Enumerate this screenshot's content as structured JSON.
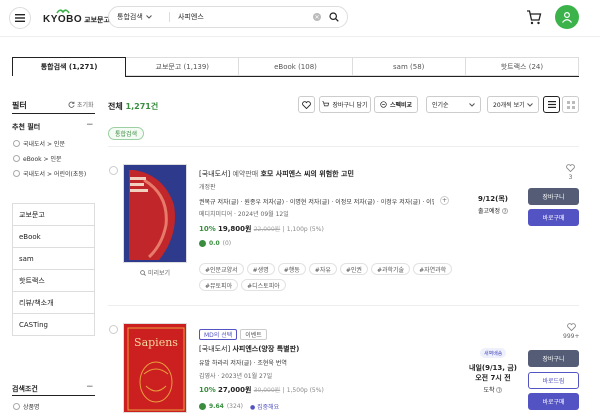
{
  "header": {
    "logo_text": "KYOBO",
    "logo_ko": "교보문고",
    "search_scope": "통합검색",
    "search_value": "사피엔스"
  },
  "tabs": [
    {
      "label": "통합검색 (1,271)",
      "active": true
    },
    {
      "label": "교보문고 (1,139)"
    },
    {
      "label": "eBook (108)"
    },
    {
      "label": "sam (58)"
    },
    {
      "label": "핫트랙스 (24)"
    }
  ],
  "filter": {
    "title": "필터",
    "reset": "초기화",
    "recommend_title": "추천 필터",
    "chips": [
      "국내도서 > 인문",
      "eBook > 인문",
      "국내도서 > 어린이(초등)"
    ],
    "menu": [
      "교보문고",
      "eBook",
      "sam",
      "핫트랙스",
      "리뷰/책소개",
      "CASTing"
    ],
    "search_cond_title": "검색조건",
    "product_name": "상품명"
  },
  "results": {
    "total_label": "전체",
    "total_count": "1,271건",
    "tools": {
      "cart": "장바구니 담기",
      "compare": "스펙비교",
      "sort": "인기순",
      "per_page": "20개씩 보기"
    },
    "category_badge": "통합검색",
    "items": [
      {
        "category": "[국내도서]",
        "status": "예약판매",
        "title": "호모 사피엔스 씨의 위험한 고민",
        "subtitle": "개정판",
        "authors": "권복규 저자(글) · 원종우 저자(글) · 이명현 저자(글) · 이정모 저자(글) · 이정우 저자(글) · 이필립",
        "more_authors": "+",
        "publisher": "메디치미디어 · 2024년 09월 12일",
        "discount": "10%",
        "price": "19,800원",
        "original_price": "22,000원",
        "points": "1,100p (5%)",
        "rating": "0.0",
        "review_count": "(0)",
        "tags": [
          "#인문교양서",
          "#생명",
          "#행동",
          "#자유",
          "#인권",
          "#과학기술",
          "#자연과학",
          "#뮤토피아",
          "#디스토피아"
        ],
        "preview": "미리보기",
        "like_count": "3",
        "delivery_date": "9/12(목)",
        "delivery_note": "출고예정",
        "btn_cart": "장바구니",
        "btn_buy": "바로구매"
      },
      {
        "badge_md": "MD의 선택",
        "badge_event": "이벤트",
        "category": "[국내도서]",
        "title": "사피엔스(양장 특별판)",
        "authors": "유발 하라리 저자(글) · 조현욱 번역",
        "publisher": "김영사 · 2023년 01월 27일",
        "discount": "10%",
        "price": "27,000원",
        "original_price": "30,000원",
        "points": "1,500p (5%)",
        "rating": "9.64",
        "review_count": "(324)",
        "hot_label": "집중해요",
        "like_count": "999+",
        "delivery_badge": "새벽배송",
        "delivery_date": "내일(9/13, 금)",
        "delivery_time": "오전 7시 전",
        "delivery_note": "도착",
        "btn_cart": "장바구니",
        "btn_gift": "바로드림",
        "btn_buy": "바로구매"
      }
    ]
  },
  "colors": {
    "accent_green": "#3a8d3f",
    "buy_purple": "#5353c4",
    "cart_gray": "#545d75",
    "user_green": "#3bb34a"
  }
}
